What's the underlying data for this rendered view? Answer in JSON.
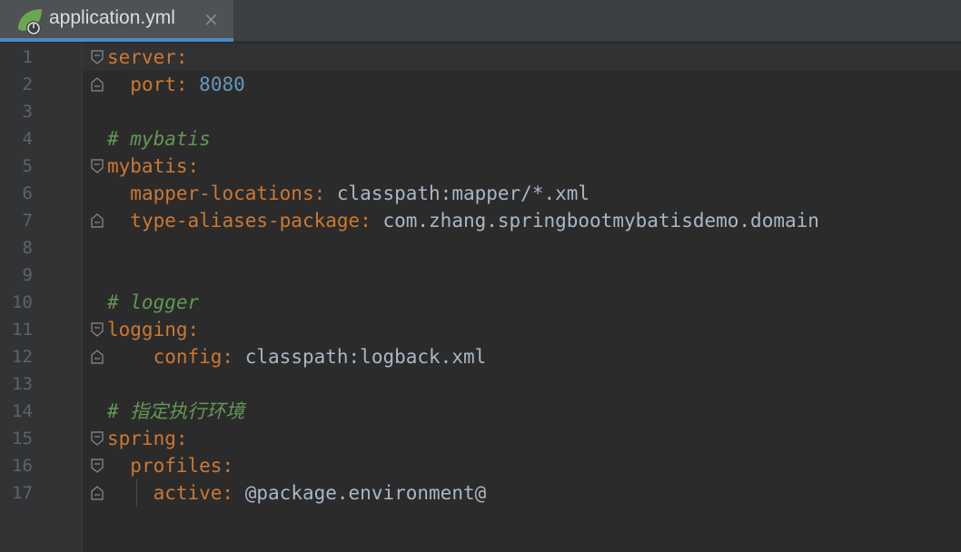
{
  "tab": {
    "title": "application.yml",
    "close_glyph": "×",
    "icon": "spring-yml-icon"
  },
  "editor": {
    "line_numbers": [
      "1",
      "2",
      "3",
      "4",
      "5",
      "6",
      "7",
      "8",
      "9",
      "10",
      "11",
      "12",
      "13",
      "14",
      "15",
      "16",
      "17"
    ],
    "lines": {
      "l1": {
        "key": "server:"
      },
      "l2": {
        "key": "port:",
        "value": "8080"
      },
      "l4": {
        "comment": "# mybatis"
      },
      "l5": {
        "key": "mybatis:"
      },
      "l6": {
        "key": "mapper-locations:",
        "value": "classpath:mapper/*.xml"
      },
      "l7": {
        "key": "type-aliases-package:",
        "value": "com.zhang.springbootmybatisdemo.domain"
      },
      "l10": {
        "comment": "# logger"
      },
      "l11": {
        "key": "logging:"
      },
      "l12": {
        "key": "config:",
        "value": "classpath:logback.xml"
      },
      "l14": {
        "comment": "# 指定执行环境"
      },
      "l15": {
        "key": "spring:"
      },
      "l16": {
        "key": "profiles:"
      },
      "l17": {
        "key": "active:",
        "value": "@package.environment@"
      }
    }
  },
  "colors": {
    "background": "#2b2b2b",
    "key": "#cc7832",
    "number": "#6897bb",
    "comment": "#629755",
    "text": "#a9b7c6",
    "tab_accent": "#4a88c7"
  }
}
